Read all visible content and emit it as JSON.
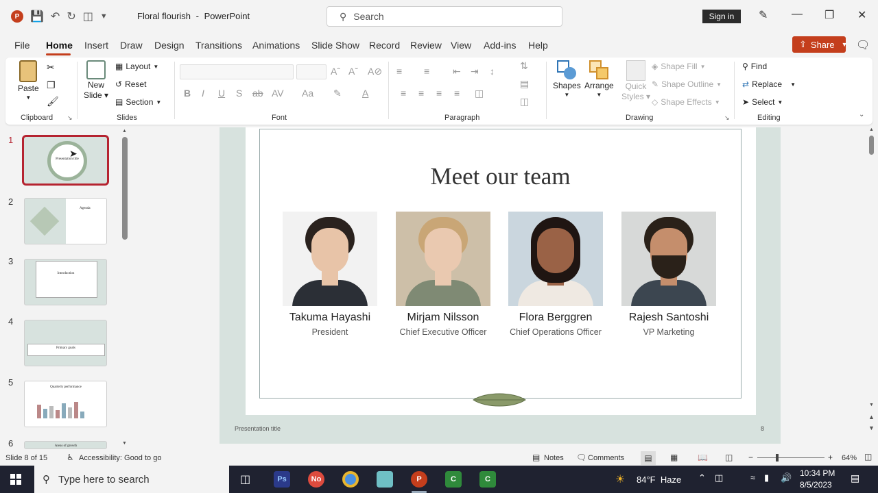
{
  "app": {
    "doc_title": "Floral flourish",
    "app_name": "PowerPoint",
    "separator": "-"
  },
  "search": {
    "placeholder": "Search"
  },
  "account": {
    "sign_in": "Sign in"
  },
  "menu": [
    "File",
    "Home",
    "Insert",
    "Draw",
    "Design",
    "Transitions",
    "Animations",
    "Slide Show",
    "Record",
    "Review",
    "View",
    "Add-ins",
    "Help"
  ],
  "share": {
    "label": "Share"
  },
  "ribbon": {
    "clipboard": {
      "paste": "Paste",
      "label": "Clipboard"
    },
    "slides": {
      "new_slide_1": "New",
      "new_slide_2": "Slide",
      "layout": "Layout",
      "reset": "Reset",
      "section": "Section",
      "label": "Slides"
    },
    "font": {
      "label": "Font"
    },
    "paragraph": {
      "label": "Paragraph"
    },
    "drawing": {
      "shapes": "Shapes",
      "arrange": "Arrange",
      "quick_styles_1": "Quick",
      "quick_styles_2": "Styles",
      "shape_fill": "Shape Fill",
      "shape_outline": "Shape Outline",
      "shape_effects": "Shape Effects",
      "label": "Drawing"
    },
    "editing": {
      "find": "Find",
      "replace": "Replace",
      "select": "Select",
      "label": "Editing"
    }
  },
  "thumbnails": [
    {
      "num": "1",
      "title": "Presentation title"
    },
    {
      "num": "2",
      "title": "Agenda"
    },
    {
      "num": "3",
      "title": "Introduction"
    },
    {
      "num": "4",
      "title": "Primary goals"
    },
    {
      "num": "5",
      "title": "Quarterly performance"
    },
    {
      "num": "6",
      "title": "Areas of growth"
    }
  ],
  "slide": {
    "title": "Meet our team",
    "people": [
      {
        "name": "Takuma Hayashi",
        "role": "President",
        "skin": "#e8c4a8",
        "hair": "#2a221e",
        "bg": "#f2f2f2",
        "shirt": "#2b2f36"
      },
      {
        "name": "Mirjam Nilsson",
        "role": "Chief Executive Officer",
        "skin": "#eac9b0",
        "hair": "#c9a676",
        "bg": "#cdbfa8",
        "shirt": "#7f8a74"
      },
      {
        "name": "Flora Berggren",
        "role": "Chief Operations Officer",
        "skin": "#9a6246",
        "hair": "#1f1512",
        "bg": "#cad6de",
        "shirt": "#efe9e2"
      },
      {
        "name": "Rajesh Santoshi",
        "role": "VP Marketing",
        "skin": "#c58e6c",
        "hair": "#2a2119",
        "bg": "#d7d9d8",
        "shirt": "#3c4650"
      }
    ],
    "footer_title": "Presentation title",
    "page_number": "8"
  },
  "status": {
    "slide_count": "Slide 8 of 15",
    "accessibility": "Accessibility: Good to go",
    "notes": "Notes",
    "comments": "Comments",
    "zoom": "64%"
  },
  "taskbar": {
    "search_placeholder": "Type here to search",
    "weather": "84°F  Haze",
    "time": "10:34 PM",
    "date": "8/5/2023"
  }
}
